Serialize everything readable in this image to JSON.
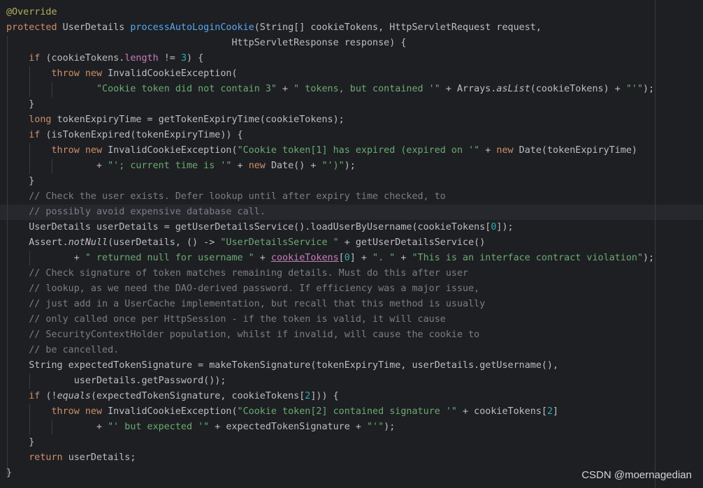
{
  "colors": {
    "background": "#1e1f22",
    "keyword": "#cf8e6d",
    "function": "#56a8f5",
    "string": "#6aab73",
    "number": "#2aacb8",
    "comment": "#7a7e85",
    "annotation": "#b3ae60",
    "field": "#c77dbb",
    "default": "#bcbec4"
  },
  "code_lines": [
    [
      [
        "anno",
        "@Override"
      ]
    ],
    [
      [
        "kw",
        "protected "
      ],
      [
        "p",
        "UserDetails "
      ],
      [
        "fn",
        "processAutoLoginCookie"
      ],
      [
        "p",
        "(String[] cookieTokens, HttpServletRequest request,"
      ]
    ],
    [
      [
        "p",
        "                                        HttpServletResponse response) {"
      ]
    ],
    [
      [
        "p",
        "    "
      ],
      [
        "kw",
        "if "
      ],
      [
        "p",
        "(cookieTokens."
      ],
      [
        "field",
        "length"
      ],
      [
        "p",
        " != "
      ],
      [
        "num",
        "3"
      ],
      [
        "p",
        ") {"
      ]
    ],
    [
      [
        "p",
        "        "
      ],
      [
        "kw",
        "throw new "
      ],
      [
        "p",
        "InvalidCookieException("
      ]
    ],
    [
      [
        "p",
        "                "
      ],
      [
        "str",
        "\"Cookie token did not contain 3\""
      ],
      [
        "p",
        " + "
      ],
      [
        "str",
        "\" tokens, but contained '\""
      ],
      [
        "p",
        " + Arrays."
      ],
      [
        "static",
        "asList"
      ],
      [
        "p",
        "(cookieTokens) + "
      ],
      [
        "str",
        "\"'\""
      ],
      [
        "p",
        ");"
      ]
    ],
    [
      [
        "p",
        "    }"
      ]
    ],
    [
      [
        "p",
        "    "
      ],
      [
        "kw",
        "long "
      ],
      [
        "p",
        "tokenExpiryTime = getTokenExpiryTime(cookieTokens);"
      ]
    ],
    [
      [
        "p",
        "    "
      ],
      [
        "kw",
        "if "
      ],
      [
        "p",
        "(isTokenExpired(tokenExpiryTime)) {"
      ]
    ],
    [
      [
        "p",
        "        "
      ],
      [
        "kw",
        "throw new "
      ],
      [
        "p",
        "InvalidCookieException("
      ],
      [
        "str",
        "\"Cookie token[1] has expired (expired on '\""
      ],
      [
        "p",
        " + "
      ],
      [
        "kw",
        "new "
      ],
      [
        "p",
        "Date(tokenExpiryTime)"
      ]
    ],
    [
      [
        "p",
        "                + "
      ],
      [
        "str",
        "\"'; current time is '\""
      ],
      [
        "p",
        " + "
      ],
      [
        "kw",
        "new "
      ],
      [
        "p",
        "Date() + "
      ],
      [
        "str",
        "\"')\""
      ],
      [
        "p",
        ");"
      ]
    ],
    [
      [
        "p",
        "    }"
      ]
    ],
    [
      [
        "p",
        "    "
      ],
      [
        "cmt",
        "// Check the user exists. Defer lookup until after expiry time checked, to"
      ]
    ],
    [
      [
        "p",
        "    "
      ],
      [
        "cmt",
        "// possibly avoid expensive database call."
      ]
    ],
    [
      [
        "p",
        "    UserDetails userDetails = getUserDetailsService().loadUserByUsername(cookieTokens["
      ],
      [
        "num",
        "0"
      ],
      [
        "p",
        "]);"
      ]
    ],
    [
      [
        "p",
        "    Assert."
      ],
      [
        "static",
        "notNull"
      ],
      [
        "p",
        "(userDetails, () -> "
      ],
      [
        "str",
        "\"UserDetailsService \""
      ],
      [
        "p",
        " + getUserDetailsService()"
      ]
    ],
    [
      [
        "p",
        "            + "
      ],
      [
        "str",
        "\" returned null for username \""
      ],
      [
        "p",
        " + "
      ],
      [
        "ul",
        "cookieTokens"
      ],
      [
        "p",
        "["
      ],
      [
        "num",
        "0"
      ],
      [
        "p",
        "] + "
      ],
      [
        "str",
        "\". \""
      ],
      [
        "p",
        " + "
      ],
      [
        "str",
        "\"This is an interface contract violation\""
      ],
      [
        "p",
        ");"
      ]
    ],
    [
      [
        "p",
        "    "
      ],
      [
        "cmt",
        "// Check signature of token matches remaining details. Must do this after user"
      ]
    ],
    [
      [
        "p",
        "    "
      ],
      [
        "cmt",
        "// lookup, as we need the DAO-derived password. If efficiency was a major issue,"
      ]
    ],
    [
      [
        "p",
        "    "
      ],
      [
        "cmt",
        "// just add in a UserCache implementation, but recall that this method is usually"
      ]
    ],
    [
      [
        "p",
        "    "
      ],
      [
        "cmt",
        "// only called once per HttpSession - if the token is valid, it will cause"
      ]
    ],
    [
      [
        "p",
        "    "
      ],
      [
        "cmt",
        "// SecurityContextHolder population, whilst if invalid, will cause the cookie to"
      ]
    ],
    [
      [
        "p",
        "    "
      ],
      [
        "cmt",
        "// be cancelled."
      ]
    ],
    [
      [
        "p",
        "    String expectedTokenSignature = makeTokenSignature(tokenExpiryTime, userDetails.getUsername(),"
      ]
    ],
    [
      [
        "p",
        "            userDetails.getPassword());"
      ]
    ],
    [
      [
        "p",
        "    "
      ],
      [
        "kw",
        "if "
      ],
      [
        "p",
        "(!"
      ],
      [
        "static",
        "equals"
      ],
      [
        "p",
        "(expectedTokenSignature, cookieTokens["
      ],
      [
        "num",
        "2"
      ],
      [
        "p",
        "])) {"
      ]
    ],
    [
      [
        "p",
        "        "
      ],
      [
        "kw",
        "throw new "
      ],
      [
        "p",
        "InvalidCookieException("
      ],
      [
        "str",
        "\"Cookie token[2] contained signature '\""
      ],
      [
        "p",
        " + cookieTokens["
      ],
      [
        "num",
        "2"
      ],
      [
        "p",
        "]"
      ]
    ],
    [
      [
        "p",
        "                + "
      ],
      [
        "str",
        "\"' but expected '\""
      ],
      [
        "p",
        " + expectedTokenSignature + "
      ],
      [
        "str",
        "\"'\""
      ],
      [
        "p",
        ");"
      ]
    ],
    [
      [
        "p",
        "    }"
      ]
    ],
    [
      [
        "p",
        "    "
      ],
      [
        "kw",
        "return "
      ],
      [
        "p",
        "userDetails;"
      ]
    ],
    [
      [
        "p",
        "}"
      ]
    ]
  ],
  "watermark": {
    "text": "CSDN @moernagedian"
  }
}
